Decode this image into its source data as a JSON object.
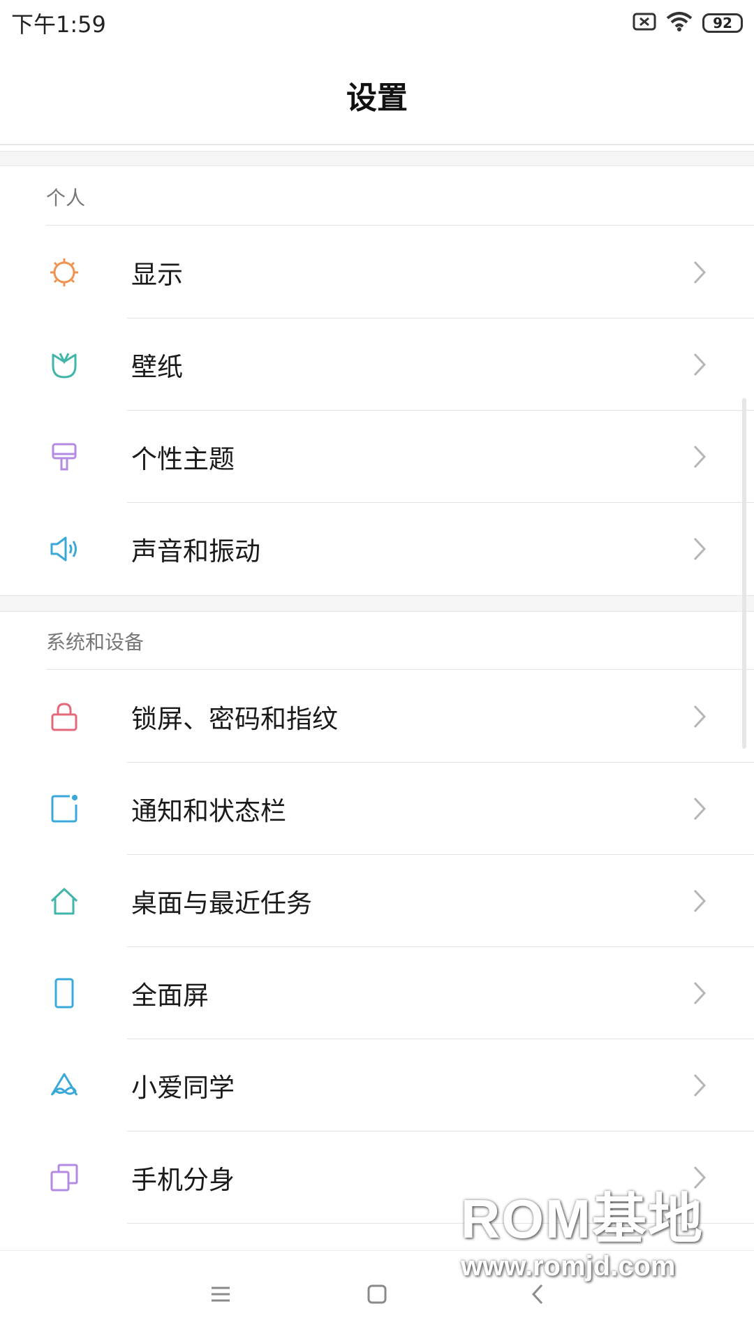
{
  "status_bar": {
    "time": "下午1:59",
    "battery": "92",
    "icons": [
      "sim-missing-icon",
      "wifi-icon",
      "battery-icon"
    ]
  },
  "header": {
    "title": "设置"
  },
  "sections": [
    {
      "title": "个人",
      "items": [
        {
          "label": "显示",
          "icon": "brightness-icon",
          "color": "#f0924f"
        },
        {
          "label": "壁纸",
          "icon": "wallpaper-tulip-icon",
          "color": "#3fb6a8"
        },
        {
          "label": "个性主题",
          "icon": "theme-brush-icon",
          "color": "#b48be3"
        },
        {
          "label": "声音和振动",
          "icon": "speaker-icon",
          "color": "#3aa8d8"
        }
      ]
    },
    {
      "title": "系统和设备",
      "items": [
        {
          "label": "锁屏、密码和指纹",
          "icon": "lock-icon",
          "color": "#e5677a"
        },
        {
          "label": "通知和状态栏",
          "icon": "notification-icon",
          "color": "#3aa8d8"
        },
        {
          "label": "桌面与最近任务",
          "icon": "home-icon",
          "color": "#3fb6a8"
        },
        {
          "label": "全面屏",
          "icon": "phone-fullscreen-icon",
          "color": "#3aa8d8"
        },
        {
          "label": "小爱同学",
          "icon": "xiaoai-icon",
          "color": "#3aa8d8"
        },
        {
          "label": "手机分身",
          "icon": "second-space-icon",
          "color": "#b48be3"
        }
      ]
    }
  ],
  "watermark": {
    "title": "ROM基地",
    "url": "www.romjd.com"
  }
}
